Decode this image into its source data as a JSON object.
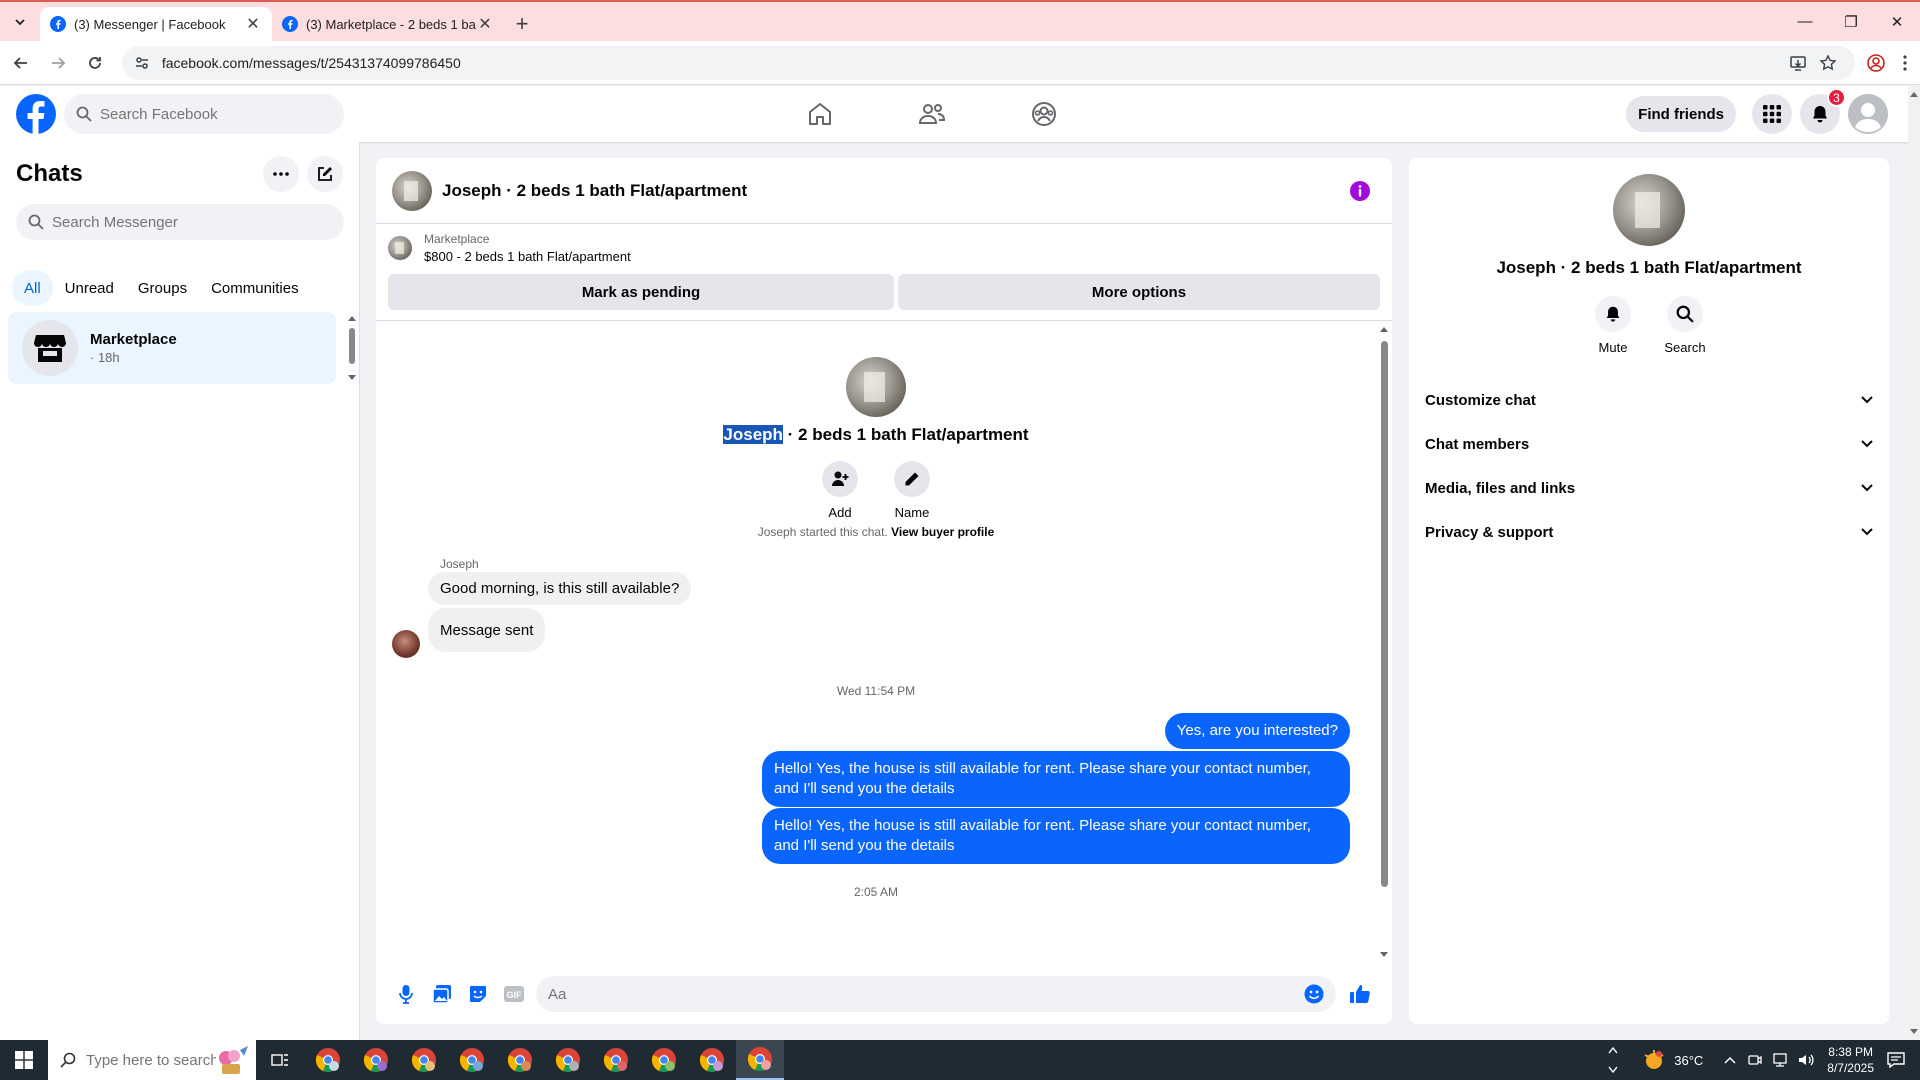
{
  "browser": {
    "tabs": [
      {
        "title": "(3) Messenger | Facebook",
        "active": true
      },
      {
        "title": "(3) Marketplace - 2 beds 1 bath Flat/apartment",
        "active": false
      }
    ],
    "url": "facebook.com/messages/t/25431374099786450"
  },
  "fb_nav": {
    "search_placeholder": "Search Facebook",
    "find_friends": "Find friends",
    "notification_count": "3"
  },
  "chats": {
    "title": "Chats",
    "search_placeholder": "Search Messenger",
    "filters": [
      "All",
      "Unread",
      "Groups",
      "Communities"
    ],
    "items": [
      {
        "name": "Marketplace",
        "meta": "· 18h"
      }
    ]
  },
  "conversation": {
    "title": "Joseph · 2 beds 1 bath Flat/apartment",
    "listing": {
      "label": "Marketplace",
      "desc": "$800 - 2 beds 1 bath Flat/apartment",
      "mark_pending": "Mark as pending",
      "more_options": "More options"
    },
    "intro": {
      "name_highlight": "Joseph",
      "name_rest": " · 2 beds 1 bath Flat/apartment",
      "add_label": "Add",
      "name_label": "Name"
    },
    "system_message": "Joseph started this chat.",
    "system_link": "View buyer profile",
    "sender": "Joseph",
    "incoming": [
      "Good morning, is this still available?",
      "Message sent"
    ],
    "timestamp_1": "Wed 11:54 PM",
    "outgoing": [
      "Yes, are you interested?",
      "Hello! Yes, the house is still available for rent. Please share your contact number, and I'll send you the details",
      "Hello! Yes, the house is still available for rent. Please share your contact number, and I'll send you the details"
    ],
    "timestamp_2": "2:05 AM",
    "composer_placeholder": "Aa"
  },
  "info_panel": {
    "name": "Joseph · 2 beds 1 bath Flat/apartment",
    "mute_label": "Mute",
    "search_label": "Search",
    "sections": [
      "Customize chat",
      "Chat members",
      "Media, files and links",
      "Privacy & support"
    ]
  },
  "taskbar": {
    "search_placeholder": "Type here to search",
    "temperature": "36°C",
    "time": "8:38 PM",
    "date": "8/7/2025"
  },
  "colors": {
    "fb_blue": "#0866ff",
    "bubble_out": "#0a65ff",
    "tabbar": "#fbdedd"
  }
}
